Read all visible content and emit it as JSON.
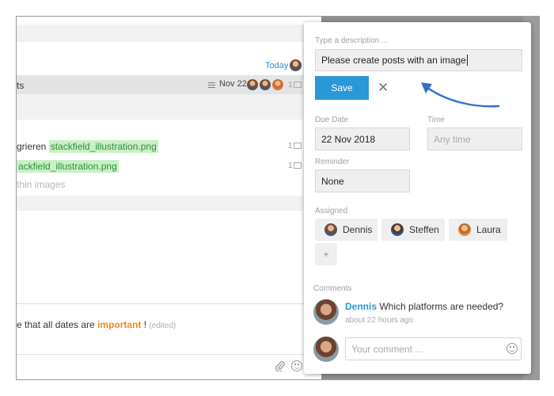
{
  "background": {
    "today_label": "Today",
    "highlighted_row": {
      "text": "ts",
      "date": "Nov 22",
      "count": "1"
    },
    "file_rows": [
      {
        "prefix": "grieren ",
        "file": "stackfield_illustration.png",
        "count": "1"
      },
      {
        "prefix": "",
        "file": "ackfield_illustration.png",
        "count": "1"
      }
    ],
    "faded_text": "thin images",
    "note": {
      "prefix": "e that all dates are ",
      "highlight": "important",
      "suffix": " !",
      "edited": "(edited)"
    }
  },
  "editor": {
    "description_label": "Type a description ...",
    "description_value": "Please create posts with an image",
    "save_label": "Save",
    "close_glyph": "✕",
    "due_date_label": "Due Date",
    "due_date_value": "22 Nov 2018",
    "time_label": "Time",
    "time_placeholder": "Any time",
    "reminder_label": "Reminder",
    "reminder_value": "None",
    "assigned_label": "Assigned",
    "assignees": [
      "Dennis",
      "Steffen",
      "Laura"
    ],
    "add_label": "+",
    "comments_label": "Comments",
    "comment": {
      "author": "Dennis",
      "text": "Which platforms are needed?",
      "time": "about 22 hours ago"
    },
    "comment_placeholder": "Your comment ..."
  },
  "colors": {
    "accent": "#2a97d6",
    "arrow": "#2f6fd0",
    "file_tag_bg": "#c9f1c6",
    "important": "#f08a1c"
  }
}
